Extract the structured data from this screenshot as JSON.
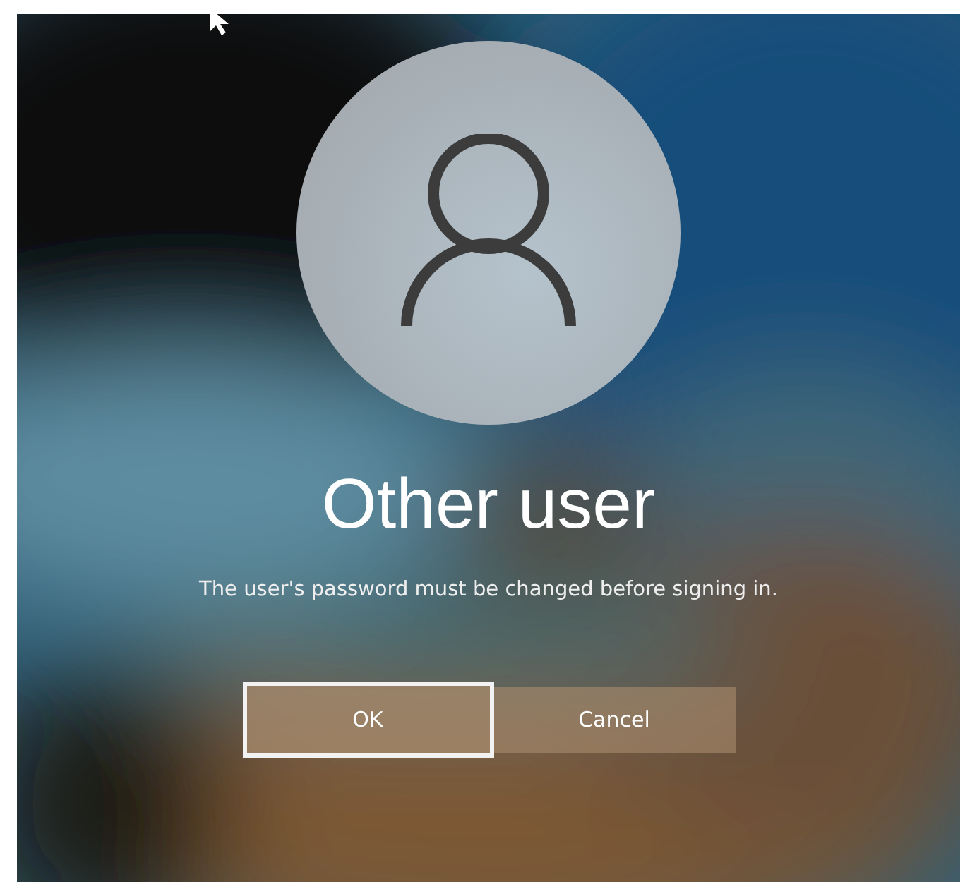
{
  "user": {
    "name": "Other user"
  },
  "message": "The user's password must be changed before signing in.",
  "buttons": [
    {
      "label": "OK",
      "focused": true
    },
    {
      "label": "Cancel",
      "focused": false
    }
  ]
}
